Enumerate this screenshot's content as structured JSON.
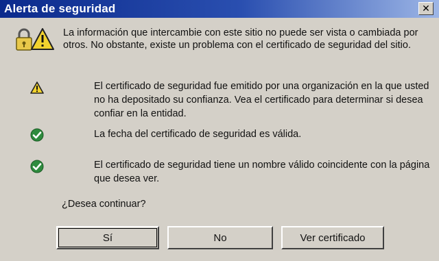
{
  "window": {
    "title": "Alerta de seguridad",
    "close_glyph": "✕"
  },
  "intro": {
    "text": "La información que intercambie con este sitio no puede ser vista o cambiada por otros. No obstante, existe un problema con el certificado de seguridad del sitio.",
    "icon": "security-lock-warning-icon"
  },
  "checks": [
    {
      "status": "warning",
      "icon": "warning-triangle-icon",
      "text": "El certificado de seguridad fue emitido por una organización en la que usted no ha depositado su confianza. Vea el certificado para determinar si desea confiar en la entidad."
    },
    {
      "status": "ok",
      "icon": "green-check-icon",
      "text": "La fecha del certificado de seguridad es válida."
    },
    {
      "status": "ok",
      "icon": "green-check-icon",
      "text": "El certificado de seguridad tiene un nombre válido coincidente con la página que desea ver."
    }
  ],
  "question": "¿Desea continuar?",
  "buttons": {
    "yes": "Sí",
    "no": "No",
    "view_certificate": "Ver certificado"
  },
  "colors": {
    "titlebar_start": "#0b2a8c",
    "dialog_bg": "#d4d0c8",
    "ok_green": "#2e8b3e",
    "warning_yellow": "#f2d22e"
  }
}
